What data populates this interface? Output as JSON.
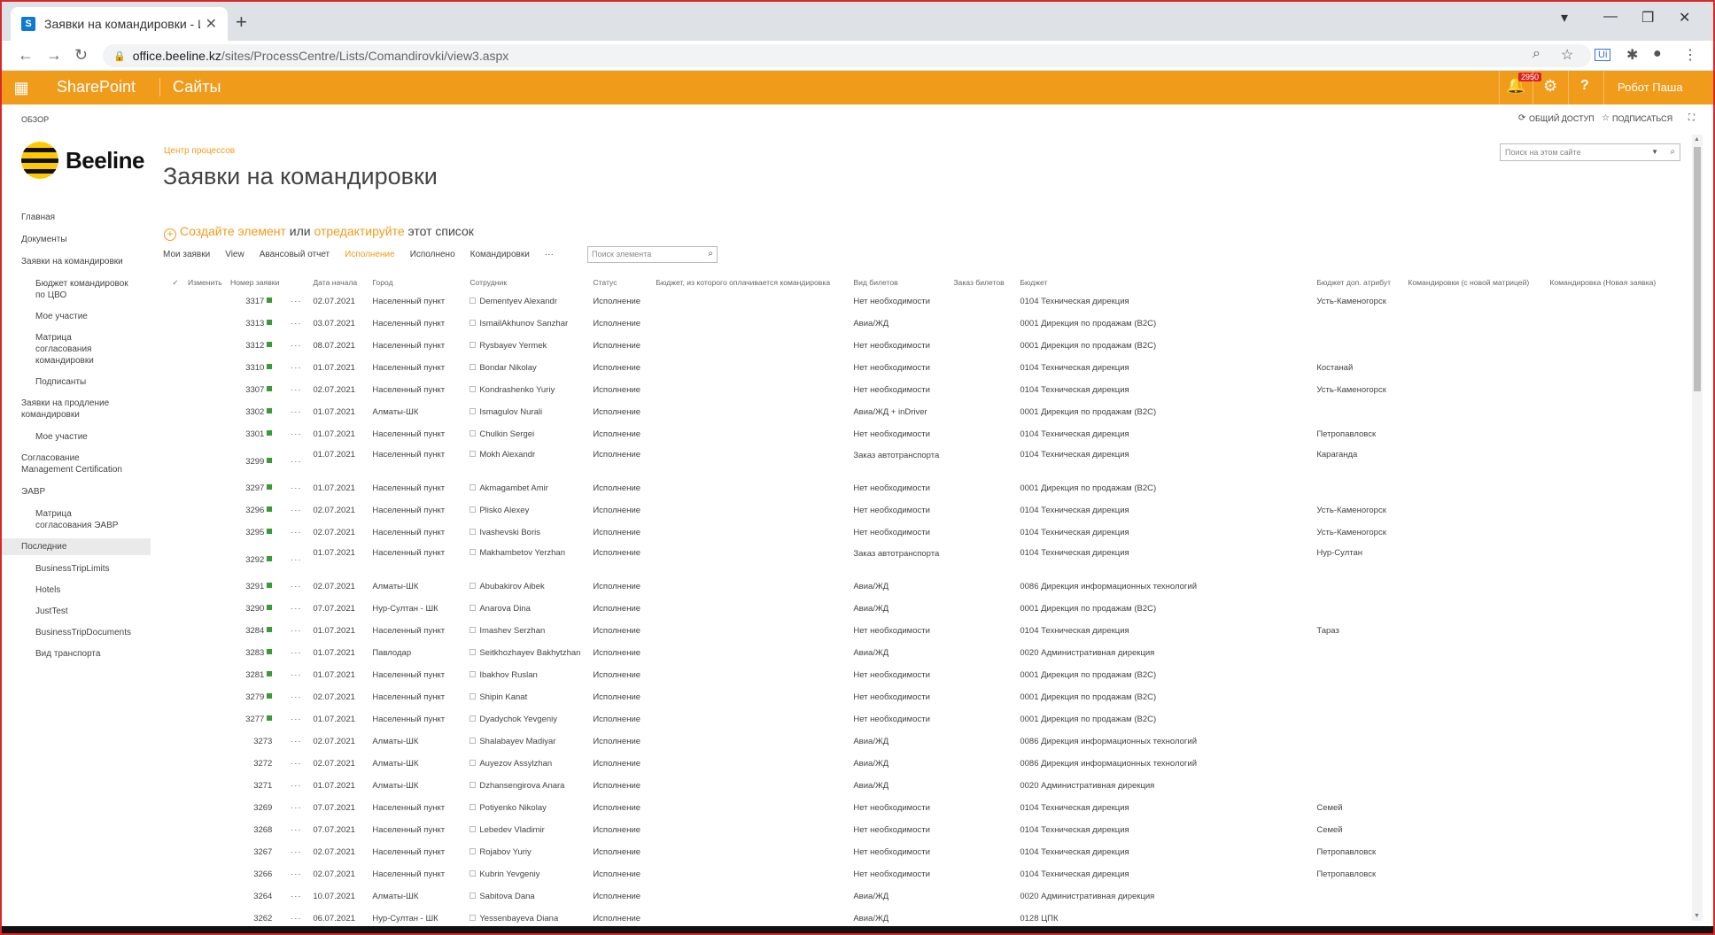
{
  "browser": {
    "tab_title": "Заявки на командировки - Исп",
    "url_host": "office.beeline.kz",
    "url_path": "/sites/ProcessCentre/Lists/Comandirovki/view3.aspx"
  },
  "suite": {
    "brand": "SharePoint",
    "sites": "Сайты",
    "notifications": "2950",
    "help": "?",
    "user": "Робот Паша"
  },
  "ribbon": {
    "browse": "ОБЗОР",
    "share": "ОБЩИЙ ДОСТУП",
    "follow": "ПОДПИСАТЬСЯ"
  },
  "logo": "Beeline",
  "nav": [
    {
      "label": "Главная",
      "level": 0
    },
    {
      "label": "Документы",
      "level": 0
    },
    {
      "label": "Заявки на командировки",
      "level": 0
    },
    {
      "label": "Бюджет командировок по ЦВО",
      "level": 1
    },
    {
      "label": "Мое участие",
      "level": 1
    },
    {
      "label": "Матрица согласования командировки",
      "level": 1
    },
    {
      "label": "Подписанты",
      "level": 1
    },
    {
      "label": "Заявки на продление командировки",
      "level": 0
    },
    {
      "label": "Мое участие",
      "level": 1
    },
    {
      "label": "Согласование Management Certification",
      "level": 0
    },
    {
      "label": "ЭАВР",
      "level": 0
    },
    {
      "label": "Матрица согласования ЭАВР",
      "level": 1
    },
    {
      "label": "Последние",
      "level": 0,
      "selected": true
    },
    {
      "label": "BusinessTripLimits",
      "level": 1
    },
    {
      "label": "Hotels",
      "level": 1
    },
    {
      "label": "JustTest",
      "level": 1
    },
    {
      "label": "BusinessTripDocuments",
      "level": 1
    },
    {
      "label": "Вид транспорта",
      "level": 1
    }
  ],
  "page": {
    "breadcrumb": "Центр процессов",
    "title": "Заявки на командировки",
    "site_search_placeholder": "Поиск на этом сайте",
    "create_label": "Создайте элемент",
    "or_label": "или",
    "edit_label": "отредактируйте",
    "list_label": "этот список",
    "item_search_placeholder": "Поиск элемента"
  },
  "views": [
    "Мои заявки",
    "View",
    "Авансовый отчет",
    "Исполнение",
    "Исполнено",
    "Командировки",
    "···"
  ],
  "active_view": "Исполнение",
  "columns": [
    "Изменить",
    "Номер заявки",
    "Дата начала",
    "Город",
    "Сотрудник",
    "Статус",
    "Бюджет, из которого оплачивается командировка",
    "Вид билетов",
    "Заказ билетов",
    "Бюджет",
    "Бюджет доп. атрибут",
    "Командировки (с новой матрицей)",
    "Командировка (Новая заявка)"
  ],
  "rows": [
    {
      "id": "3317",
      "new": true,
      "date": "02.07.2021",
      "city": "Населенный пункт",
      "emp": "Dementyev Alexandr",
      "status": "Исполнение",
      "ticket": "Нет необходимости",
      "budget": "0104 Техническая дирекция",
      "attr": "Усть-Каменогорск"
    },
    {
      "id": "3313",
      "new": true,
      "date": "03.07.2021",
      "city": "Населенный пункт",
      "emp": "IsmailAkhunov Sanzhar",
      "status": "Исполнение",
      "ticket": "Авиа/ЖД",
      "budget": "0001 Дирекция по продажам (B2C)",
      "attr": ""
    },
    {
      "id": "3312",
      "new": true,
      "date": "08.07.2021",
      "city": "Населенный пункт",
      "emp": "Rysbayev Yermek",
      "status": "Исполнение",
      "ticket": "Нет необходимости",
      "budget": "0001 Дирекция по продажам (B2C)",
      "attr": ""
    },
    {
      "id": "3310",
      "new": true,
      "date": "01.07.2021",
      "city": "Населенный пункт",
      "emp": "Bondar Nikolay",
      "status": "Исполнение",
      "ticket": "Нет необходимости",
      "budget": "0104 Техническая дирекция",
      "attr": "Костанай"
    },
    {
      "id": "3307",
      "new": true,
      "date": "02.07.2021",
      "city": "Населенный пункт",
      "emp": "Kondrashenko Yuriy",
      "status": "Исполнение",
      "ticket": "Нет необходимости",
      "budget": "0104 Техническая дирекция",
      "attr": "Усть-Каменогорск"
    },
    {
      "id": "3302",
      "new": true,
      "date": "01.07.2021",
      "city": "Алматы-ШК",
      "emp": "Ismagulov Nurali",
      "status": "Исполнение",
      "ticket": "Авиа/ЖД + inDriver",
      "budget": "0001 Дирекция по продажам (B2C)",
      "attr": ""
    },
    {
      "id": "3301",
      "new": true,
      "date": "01.07.2021",
      "city": "Населенный пункт",
      "emp": "Chulkin Sergei",
      "status": "Исполнение",
      "ticket": "Нет необходимости",
      "budget": "0104 Техническая дирекция",
      "attr": "Петропавловск"
    },
    {
      "id": "3299",
      "new": true,
      "date": "01.07.2021",
      "city": "Населенный пункт",
      "emp": "Mokh Alexandr",
      "status": "Исполнение",
      "ticket": "Заказ автотранспорта",
      "budget": "0104 Техническая дирекция",
      "attr": "Караганда",
      "tall": true
    },
    {
      "id": "3297",
      "new": true,
      "date": "01.07.2021",
      "city": "Населенный пункт",
      "emp": "Akmagambet Amir",
      "status": "Исполнение",
      "ticket": "Нет необходимости",
      "budget": "0001 Дирекция по продажам (B2C)",
      "attr": ""
    },
    {
      "id": "3296",
      "new": true,
      "date": "02.07.2021",
      "city": "Населенный пункт",
      "emp": "Plisko Alexey",
      "status": "Исполнение",
      "ticket": "Нет необходимости",
      "budget": "0104 Техническая дирекция",
      "attr": "Усть-Каменогорск"
    },
    {
      "id": "3295",
      "new": true,
      "date": "02.07.2021",
      "city": "Населенный пункт",
      "emp": "Ivashevski Boris",
      "status": "Исполнение",
      "ticket": "Нет необходимости",
      "budget": "0104 Техническая дирекция",
      "attr": "Усть-Каменогорск"
    },
    {
      "id": "3292",
      "new": true,
      "date": "01.07.2021",
      "city": "Населенный пункт",
      "emp": "Makhambetov Yerzhan",
      "status": "Исполнение",
      "ticket": "Заказ автотранспорта",
      "budget": "0104 Техническая дирекция",
      "attr": "Нур-Султан",
      "tall": true
    },
    {
      "id": "3291",
      "new": true,
      "date": "02.07.2021",
      "city": "Алматы-ШК",
      "emp": "Abubakirov Aibek",
      "status": "Исполнение",
      "ticket": "Авиа/ЖД",
      "budget": "0086 Дирекция информационных технологий",
      "attr": ""
    },
    {
      "id": "3290",
      "new": true,
      "date": "07.07.2021",
      "city": "Нур-Султан - ШК",
      "emp": "Anarova Dina",
      "status": "Исполнение",
      "ticket": "Авиа/ЖД",
      "budget": "0001 Дирекция по продажам (B2C)",
      "attr": ""
    },
    {
      "id": "3284",
      "new": true,
      "date": "01.07.2021",
      "city": "Населенный пункт",
      "emp": "Imashev Serzhan",
      "status": "Исполнение",
      "ticket": "Нет необходимости",
      "budget": "0104 Техническая дирекция",
      "attr": "Тараз"
    },
    {
      "id": "3283",
      "new": true,
      "date": "01.07.2021",
      "city": "Павлодар",
      "emp": "Seitkhozhayev Bakhytzhan",
      "status": "Исполнение",
      "ticket": "Авиа/ЖД",
      "budget": "0020 Административная дирекция",
      "attr": ""
    },
    {
      "id": "3281",
      "new": true,
      "date": "01.07.2021",
      "city": "Населенный пункт",
      "emp": "Ibakhov Ruslan",
      "status": "Исполнение",
      "ticket": "Нет необходимости",
      "budget": "0001 Дирекция по продажам (B2C)",
      "attr": ""
    },
    {
      "id": "3279",
      "new": true,
      "date": "02.07.2021",
      "city": "Населенный пункт",
      "emp": "Shipin Kanat",
      "status": "Исполнение",
      "ticket": "Нет необходимости",
      "budget": "0001 Дирекция по продажам (B2C)",
      "attr": ""
    },
    {
      "id": "3277",
      "new": true,
      "date": "01.07.2021",
      "city": "Населенный пункт",
      "emp": "Dyadychok Yevgeniy",
      "status": "Исполнение",
      "ticket": "Нет необходимости",
      "budget": "0001 Дирекция по продажам (B2C)",
      "attr": ""
    },
    {
      "id": "3273",
      "new": false,
      "date": "02.07.2021",
      "city": "Алматы-ШК",
      "emp": "Shalabayev Madiyar",
      "status": "Исполнение",
      "ticket": "Авиа/ЖД",
      "budget": "0086 Дирекция информационных технологий",
      "attr": ""
    },
    {
      "id": "3272",
      "new": false,
      "date": "02.07.2021",
      "city": "Алматы-ШК",
      "emp": "Auyezov Assylzhan",
      "status": "Исполнение",
      "ticket": "Авиа/ЖД",
      "budget": "0086 Дирекция информационных технологий",
      "attr": ""
    },
    {
      "id": "3271",
      "new": false,
      "date": "01.07.2021",
      "city": "Алматы-ШК",
      "emp": "Dzhansengirova Anara",
      "status": "Исполнение",
      "ticket": "Авиа/ЖД",
      "budget": "0020 Административная дирекция",
      "attr": ""
    },
    {
      "id": "3269",
      "new": false,
      "date": "07.07.2021",
      "city": "Населенный пункт",
      "emp": "Potiyenko Nikolay",
      "status": "Исполнение",
      "ticket": "Нет необходимости",
      "budget": "0104 Техническая дирекция",
      "attr": "Семей"
    },
    {
      "id": "3268",
      "new": false,
      "date": "07.07.2021",
      "city": "Населенный пункт",
      "emp": "Lebedev Vladimir",
      "status": "Исполнение",
      "ticket": "Нет необходимости",
      "budget": "0104 Техническая дирекция",
      "attr": "Семей"
    },
    {
      "id": "3267",
      "new": false,
      "date": "02.07.2021",
      "city": "Населенный пункт",
      "emp": "Rojabov Yuriy",
      "status": "Исполнение",
      "ticket": "Нет необходимости",
      "budget": "0104 Техническая дирекция",
      "attr": "Петропавловск"
    },
    {
      "id": "3266",
      "new": false,
      "date": "02.07.2021",
      "city": "Населенный пункт",
      "emp": "Kubrin Yevgeniy",
      "status": "Исполнение",
      "ticket": "Нет необходимости",
      "budget": "0104 Техническая дирекция",
      "attr": "Петропавловск"
    },
    {
      "id": "3264",
      "new": false,
      "date": "10.07.2021",
      "city": "Алматы-ШК",
      "emp": "Sabitova Dana",
      "status": "Исполнение",
      "ticket": "Авиа/ЖД",
      "budget": "0020 Административная дирекция",
      "attr": ""
    },
    {
      "id": "3262",
      "new": false,
      "date": "06.07.2021",
      "city": "Нур-Султан - ШК",
      "emp": "Yessenbayeva Diana",
      "status": "Исполнение",
      "ticket": "Авиа/ЖД",
      "budget": "0128 ЦПК",
      "attr": ""
    }
  ],
  "colors": {
    "accent": "#f19b1b",
    "frame": "#d9262b"
  }
}
